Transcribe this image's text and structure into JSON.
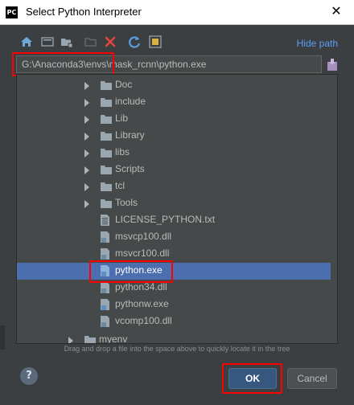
{
  "window": {
    "app_icon_text": "PC",
    "title": "Select Python Interpreter",
    "close_glyph": "✕"
  },
  "toolbar": {
    "icons": [
      "home-icon",
      "desktop-icon",
      "project-folder-icon",
      "new-folder-icon",
      "delete-icon",
      "refresh-icon",
      "show-hidden-icon"
    ],
    "hide_path_label": "Hide path"
  },
  "path": {
    "value": "G:\\Anaconda3\\envs\\mask_rcnn\\python.exe"
  },
  "tree": {
    "items": [
      {
        "label": "Doc",
        "type": "folder"
      },
      {
        "label": "include",
        "type": "folder"
      },
      {
        "label": "Lib",
        "type": "folder"
      },
      {
        "label": "Library",
        "type": "folder"
      },
      {
        "label": "libs",
        "type": "folder"
      },
      {
        "label": "Scripts",
        "type": "folder"
      },
      {
        "label": "tcl",
        "type": "folder"
      },
      {
        "label": "Tools",
        "type": "folder"
      },
      {
        "label": "LICENSE_PYTHON.txt",
        "type": "text-file"
      },
      {
        "label": "msvcp100.dll",
        "type": "dll-file"
      },
      {
        "label": "msvcr100.dll",
        "type": "dll-file"
      },
      {
        "label": "python.exe",
        "type": "exe-file",
        "selected": true
      },
      {
        "label": "python34.dll",
        "type": "dll-file"
      },
      {
        "label": "pythonw.exe",
        "type": "exe-file"
      },
      {
        "label": "vcomp100.dll",
        "type": "dll-file"
      },
      {
        "label": "myenv",
        "type": "folder"
      }
    ]
  },
  "hint": "Drag and drop a file into the space above to quickly locate it in the tree",
  "buttons": {
    "help": "?",
    "ok": "OK",
    "cancel": "Cancel"
  },
  "colors": {
    "dialog_bg": "#3c3f41",
    "selection": "#4b6eaf",
    "link": "#589df6",
    "annotation_red": "#ff0000"
  }
}
